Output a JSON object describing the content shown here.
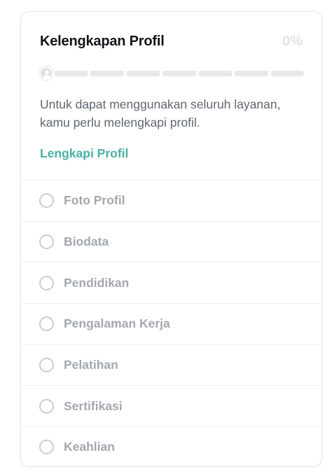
{
  "profile_card": {
    "title": "Kelengkapan Profil",
    "percent": "0%",
    "progress": {
      "completed_fraction": 0,
      "segment_count": 7
    },
    "description": "Untuk dapat menggunakan seluruh layanan, kamu perlu melengkapi profil.",
    "cta_label": "Lengkapi Profil",
    "checklist": [
      {
        "label": "Foto Profil",
        "checked": false
      },
      {
        "label": "Biodata",
        "checked": false
      },
      {
        "label": "Pendidikan",
        "checked": false
      },
      {
        "label": "Pengalaman Kerja",
        "checked": false
      },
      {
        "label": "Pelatihan",
        "checked": false
      },
      {
        "label": "Sertifikasi",
        "checked": false
      },
      {
        "label": "Keahlian",
        "checked": false
      }
    ]
  },
  "colors": {
    "accent": "#4ab0a4",
    "title": "#111418",
    "muted_text": "#a3a8b0",
    "progress_track": "#e6e8eb"
  },
  "icons": {
    "progress_start": "user-avatar-icon",
    "checklist_item": "unchecked-circle-icon"
  }
}
